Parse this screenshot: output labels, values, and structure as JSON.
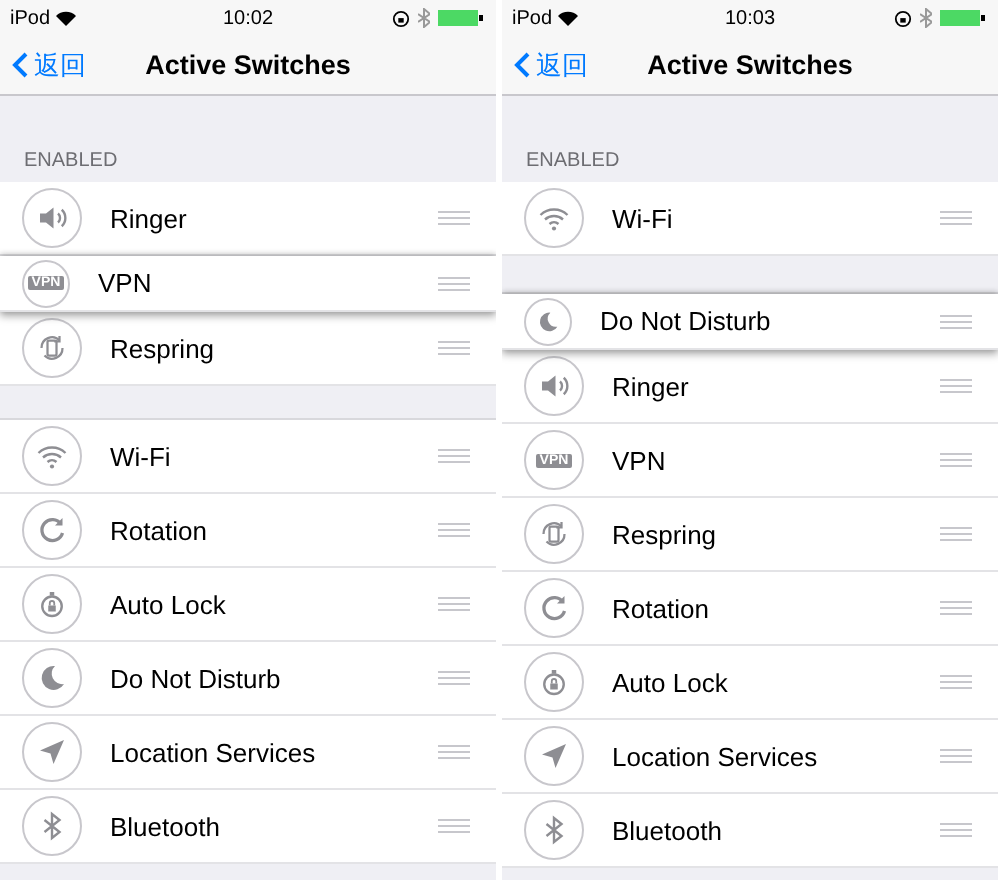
{
  "screens": [
    {
      "status_bar": {
        "carrier": "iPod",
        "time": "10:02"
      },
      "nav": {
        "back": "返回",
        "title": "Active Switches"
      },
      "section": "ENABLED",
      "items": [
        {
          "kind": "speaker",
          "label": "Ringer",
          "dragging": false
        },
        {
          "kind": "vpn",
          "label": "VPN",
          "icon_text": "VPN",
          "dragging": true
        },
        {
          "kind": "respring",
          "label": "Respring",
          "dragging": false
        },
        {
          "kind": "gap"
        },
        {
          "kind": "wifi",
          "label": "Wi-Fi",
          "dragging": false
        },
        {
          "kind": "rotation",
          "label": "Rotation",
          "dragging": false
        },
        {
          "kind": "stopwatch",
          "label": "Auto Lock",
          "dragging": false
        },
        {
          "kind": "moon",
          "label": "Do Not Disturb",
          "dragging": false
        },
        {
          "kind": "location",
          "label": "Location Services",
          "dragging": false
        },
        {
          "kind": "bluetooth",
          "label": "Bluetooth",
          "dragging": false
        }
      ]
    },
    {
      "status_bar": {
        "carrier": "iPod",
        "time": "10:03"
      },
      "nav": {
        "back": "返回",
        "title": "Active Switches"
      },
      "section": "ENABLED",
      "items": [
        {
          "kind": "wifi",
          "label": "Wi-Fi",
          "dragging": false
        },
        {
          "kind": "gap"
        },
        {
          "kind": "moon",
          "label": "Do Not Disturb",
          "dragging": true
        },
        {
          "kind": "speaker",
          "label": "Ringer",
          "dragging": false
        },
        {
          "kind": "vpn",
          "label": "VPN",
          "icon_text": "VPN",
          "dragging": false
        },
        {
          "kind": "respring",
          "label": "Respring",
          "dragging": false
        },
        {
          "kind": "rotation",
          "label": "Rotation",
          "dragging": false
        },
        {
          "kind": "stopwatch",
          "label": "Auto Lock",
          "dragging": false
        },
        {
          "kind": "location",
          "label": "Location Services",
          "dragging": false
        },
        {
          "kind": "bluetooth",
          "label": "Bluetooth",
          "dragging": false
        }
      ]
    }
  ]
}
